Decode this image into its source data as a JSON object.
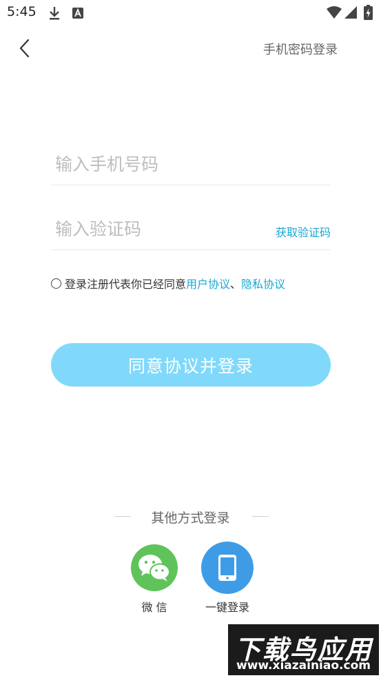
{
  "status_bar": {
    "time": "5:45",
    "icons": [
      "download-icon",
      "a-notification-icon",
      "wifi-icon",
      "signal-icon",
      "battery-icon"
    ]
  },
  "header": {
    "back_icon": "chevron-left-icon",
    "top_link": "手机密码登录"
  },
  "form": {
    "phone_placeholder": "输入手机号码",
    "phone_value": "",
    "code_placeholder": "输入验证码",
    "code_value": "",
    "get_code_label": "获取验证码"
  },
  "agreement": {
    "prefix": "登录注册代表你已经同意",
    "user_agreement": "用户协议",
    "separator": "、",
    "privacy_agreement": "隐私协议"
  },
  "login_button": "同意协议并登录",
  "other_login": {
    "title": "其他方式登录",
    "options": [
      {
        "label": "微 信",
        "icon": "wechat-icon",
        "color": "#5fc35a"
      },
      {
        "label": "一键登录",
        "icon": "phone-icon",
        "color": "#3e9ce6"
      }
    ]
  },
  "watermark": {
    "title": "下载鸟应用",
    "url": "www.xiazainiao.com"
  },
  "colors": {
    "accent": "#1aa7d1",
    "button": "#80d9fa"
  }
}
